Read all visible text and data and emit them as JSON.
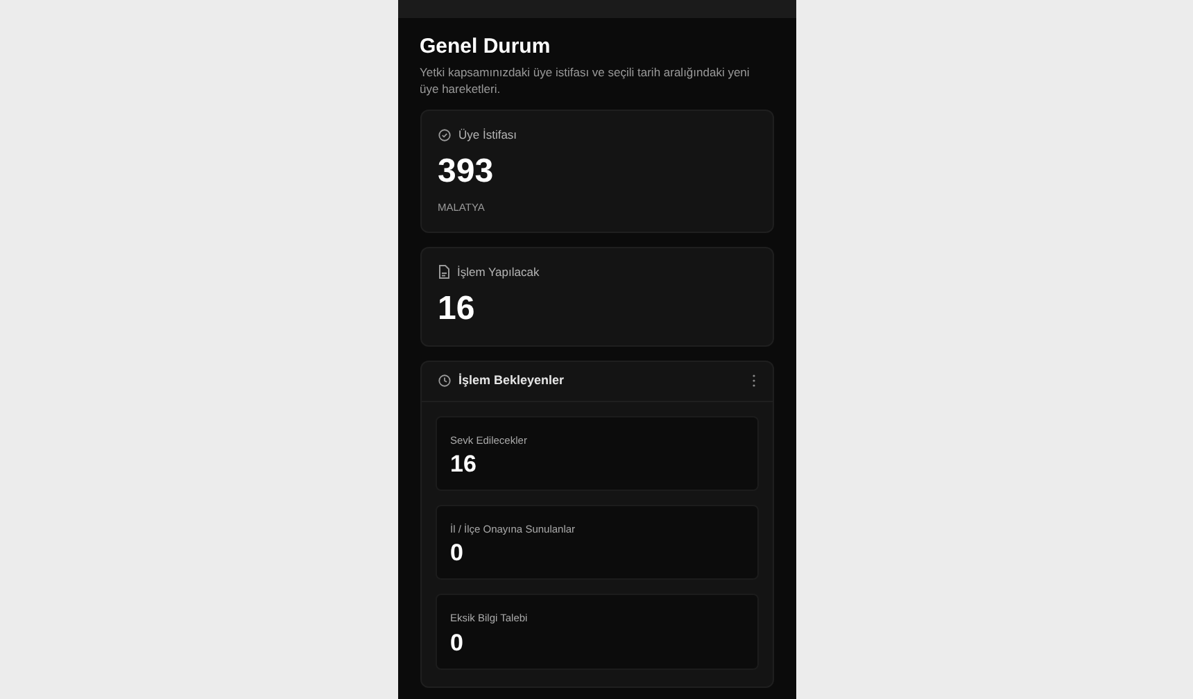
{
  "header": {
    "title": "Genel Durum",
    "subtitle": "Yetki kapsamınızdaki üye istifası ve seçili tarih aralığındaki yeni üye hareketleri."
  },
  "stats": [
    {
      "kind": "check",
      "label": "Üye İstifası",
      "value": "393",
      "caption": "MALATYA"
    },
    {
      "kind": "file",
      "label": "İşlem Yapılacak",
      "value": "16"
    }
  ],
  "pending": {
    "title": "İşlem Bekleyenler",
    "items": [
      {
        "label": "Sevk Edilecekler",
        "value": "16"
      },
      {
        "label": "İl / İlçe Onayına Sunulanlar",
        "value": "0"
      },
      {
        "label": "Eksik Bilgi Talebi",
        "value": "0"
      }
    ]
  }
}
